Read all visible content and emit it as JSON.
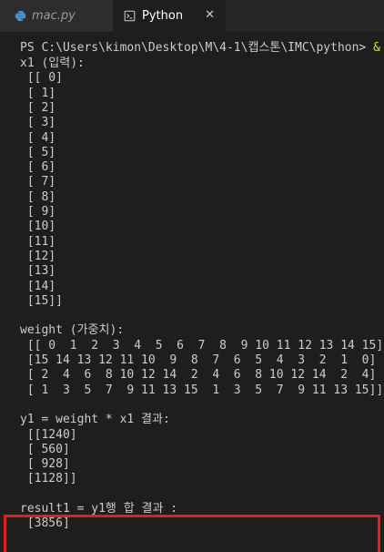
{
  "tabs": [
    {
      "label": "mac.py",
      "active": false
    },
    {
      "label": "Python",
      "active": true,
      "close_glyph": "✕"
    }
  ],
  "terminal": {
    "prompt": "PS C:\\Users\\kimon\\Desktop\\M\\4-1\\캡스톤\\IMC\\python> ",
    "command": "& C:/U",
    "lines": [
      "x1 (입력):",
      " [[ 0]",
      " [ 1]",
      " [ 2]",
      " [ 3]",
      " [ 4]",
      " [ 5]",
      " [ 6]",
      " [ 7]",
      " [ 8]",
      " [ 9]",
      " [10]",
      " [11]",
      " [12]",
      " [13]",
      " [14]",
      " [15]]",
      "",
      "weight (가중치):",
      " [[ 0  1  2  3  4  5  6  7  8  9 10 11 12 13 14 15]",
      " [15 14 13 12 11 10  9  8  7  6  5  4  3  2  1  0]",
      " [ 2  4  6  8 10 12 14  2  4  6  8 10 12 14  2  4]",
      " [ 1  3  5  7  9 11 13 15  1  3  5  7  9 11 13 15]]",
      "",
      "y1 = weight * x1 결과:",
      " [[1240]",
      " [ 560]",
      " [ 928]",
      " [1128]]",
      "",
      "result1 = y1행 합 결과 :",
      " [3856]"
    ]
  },
  "colors": {
    "background": "#1e1e1e",
    "tabbar": "#252526",
    "highlight": "#e02020",
    "command": "#e5e510"
  }
}
